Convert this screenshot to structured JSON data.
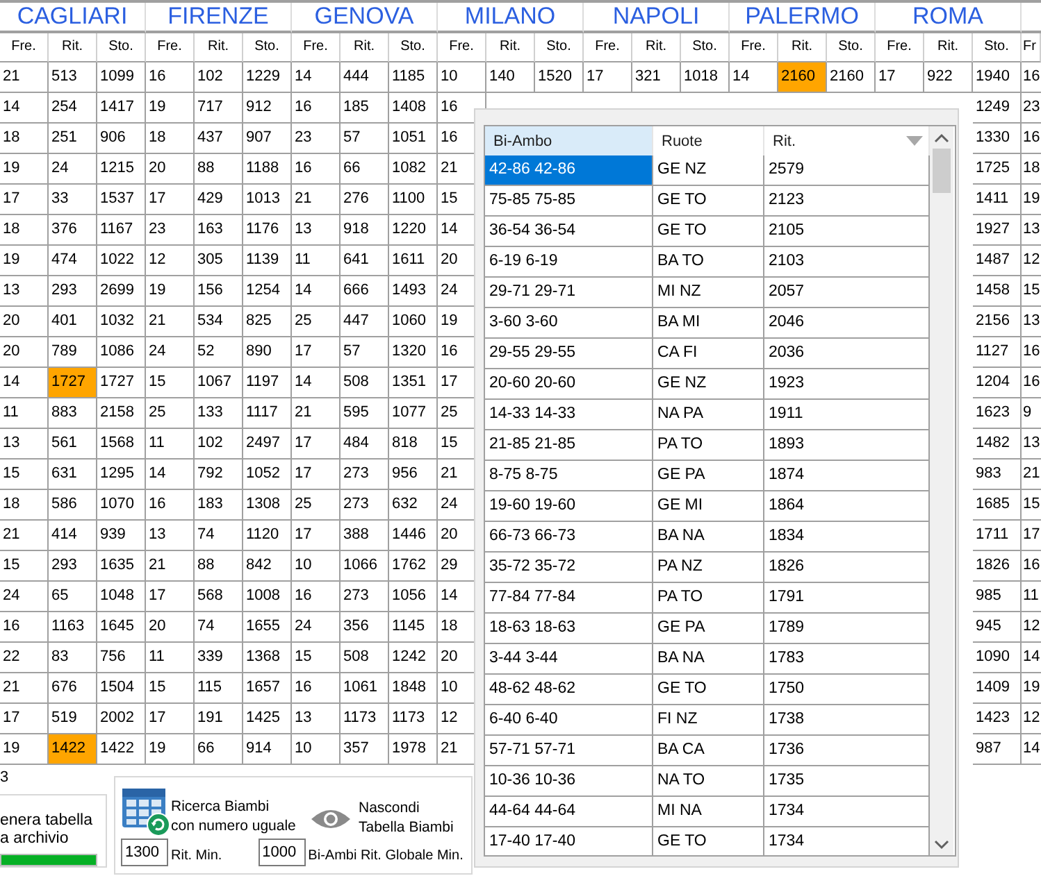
{
  "table": {
    "cities": [
      "CAGLIARI",
      "FIRENZE",
      "GENOVA",
      "MILANO",
      "NAPOLI",
      "PALERMO",
      "ROMA"
    ],
    "column_headers": [
      "Fre.",
      "Rit.",
      "Sto.",
      "Fre.",
      "Rit.",
      "Sto.",
      "Fre.",
      "Rit.",
      "Sto.",
      "Fre.",
      "Rit.",
      "Sto.",
      "Fre.",
      "Rit.",
      "Sto.",
      "Fre.",
      "Rit.",
      "Sto.",
      "Fre.",
      "Rit.",
      "Sto.",
      "Fr"
    ],
    "rows": [
      {
        "cells": [
          "21",
          "513",
          "1099",
          "16",
          "102",
          "1229",
          "14",
          "444",
          "1185",
          "10",
          "140",
          "1520",
          "17",
          "321",
          "1018",
          "14",
          {
            "text": "2160",
            "highlighted": true
          },
          "2160",
          "17",
          "922",
          "1940",
          "16"
        ]
      },
      {
        "cells": [
          "14",
          "254",
          "1417",
          "19",
          "717",
          "912",
          "16",
          "185",
          "1408",
          "16"
        ],
        "tail": [
          "1249",
          "23"
        ]
      },
      {
        "cells": [
          "18",
          "251",
          "906",
          "18",
          "437",
          "907",
          "23",
          "57",
          "1051",
          "16"
        ],
        "tail": [
          "1330",
          "16"
        ]
      },
      {
        "cells": [
          "19",
          "24",
          "1215",
          "20",
          "88",
          "1188",
          "16",
          "66",
          "1082",
          "21"
        ],
        "tail": [
          "1725",
          "18"
        ]
      },
      {
        "cells": [
          "17",
          "33",
          "1537",
          "17",
          "429",
          "1013",
          "21",
          "276",
          "1100",
          "15"
        ],
        "tail": [
          "1411",
          "19"
        ]
      },
      {
        "cells": [
          "18",
          "376",
          "1167",
          "23",
          "163",
          "1176",
          "13",
          "918",
          "1220",
          "14"
        ],
        "tail": [
          "1927",
          "13"
        ]
      },
      {
        "cells": [
          "19",
          "474",
          "1022",
          "12",
          "305",
          "1139",
          "11",
          "641",
          "1611",
          "20"
        ],
        "tail": [
          "1487",
          "12"
        ]
      },
      {
        "cells": [
          "13",
          "293",
          "2699",
          "19",
          "156",
          "1254",
          "14",
          "666",
          "1493",
          "24"
        ],
        "tail": [
          "1458",
          "15"
        ]
      },
      {
        "cells": [
          "20",
          "401",
          "1032",
          "21",
          "534",
          "825",
          "25",
          "447",
          "1060",
          "19"
        ],
        "tail": [
          "2156",
          "13"
        ]
      },
      {
        "cells": [
          "20",
          "789",
          "1086",
          "24",
          "52",
          "890",
          "17",
          "57",
          "1320",
          "16"
        ],
        "tail": [
          "1127",
          "16"
        ]
      },
      {
        "cells": [
          "14",
          {
            "text": "1727",
            "highlighted": true
          },
          "1727",
          "15",
          "1067",
          "1197",
          "14",
          "508",
          "1351",
          "17"
        ],
        "tail": [
          "1204",
          "16"
        ]
      },
      {
        "cells": [
          "11",
          "883",
          "2158",
          "25",
          "133",
          "1117",
          "21",
          "595",
          "1077",
          "25"
        ],
        "tail": [
          "1623",
          "9"
        ]
      },
      {
        "cells": [
          "13",
          "561",
          "1568",
          "11",
          "102",
          "2497",
          "17",
          "484",
          "818",
          "15"
        ],
        "tail": [
          "1482",
          "13"
        ]
      },
      {
        "cells": [
          "15",
          "631",
          "1295",
          "14",
          "792",
          "1052",
          "17",
          "273",
          "956",
          "21"
        ],
        "tail": [
          "983",
          "21"
        ]
      },
      {
        "cells": [
          "18",
          "586",
          "1070",
          "16",
          "183",
          "1308",
          "25",
          "273",
          "632",
          "24"
        ],
        "tail": [
          "1685",
          "15"
        ]
      },
      {
        "cells": [
          "21",
          "414",
          "939",
          "13",
          "74",
          "1120",
          "17",
          "388",
          "1446",
          "20"
        ],
        "tail": [
          "1711",
          "17"
        ]
      },
      {
        "cells": [
          "15",
          "293",
          "1635",
          "21",
          "88",
          "842",
          "10",
          "1066",
          "1762",
          "29"
        ],
        "tail": [
          "1826",
          "16"
        ]
      },
      {
        "cells": [
          "24",
          "65",
          "1048",
          "17",
          "568",
          "1008",
          "16",
          "273",
          "1056",
          "14"
        ],
        "tail": [
          "985",
          "11"
        ]
      },
      {
        "cells": [
          "16",
          "1163",
          "1645",
          "20",
          "74",
          "1655",
          "24",
          "356",
          "1145",
          "18"
        ],
        "tail": [
          "945",
          "12"
        ]
      },
      {
        "cells": [
          "22",
          "83",
          "756",
          "11",
          "339",
          "1368",
          "15",
          "508",
          "1242",
          "20"
        ],
        "tail": [
          "1090",
          "14"
        ]
      },
      {
        "cells": [
          "21",
          "676",
          "1504",
          "15",
          "115",
          "1657",
          "16",
          "1061",
          "1848",
          "10"
        ],
        "tail": [
          "1409",
          "19"
        ]
      },
      {
        "cells": [
          "17",
          "519",
          "2002",
          "17",
          "191",
          "1425",
          "13",
          "1173",
          "1173",
          "12"
        ],
        "tail": [
          "1423",
          "12"
        ]
      },
      {
        "cells": [
          "19",
          {
            "text": "1422",
            "highlighted": true
          },
          "1422",
          "19",
          "66",
          "914",
          "10",
          "357",
          "1978",
          "21"
        ],
        "tail": [
          "987",
          "14"
        ]
      }
    ]
  },
  "biambi_table": {
    "columns": [
      {
        "label": "Bi-Ambo",
        "highlighted": true,
        "sorted": false
      },
      {
        "label": "Ruote",
        "highlighted": false,
        "sorted": false
      },
      {
        "label": "Rit.",
        "highlighted": false,
        "sorted": true
      }
    ],
    "rows": [
      {
        "cells": [
          "42-86 42-86",
          "GE NZ",
          "2579"
        ],
        "selected": true
      },
      {
        "cells": [
          "75-85 75-85",
          "GE TO",
          "2123"
        ],
        "selected": false
      },
      {
        "cells": [
          "36-54 36-54",
          "GE TO",
          "2105"
        ],
        "selected": false
      },
      {
        "cells": [
          "6-19 6-19",
          "BA TO",
          "2103"
        ],
        "selected": false
      },
      {
        "cells": [
          "29-71 29-71",
          "MI NZ",
          "2057"
        ],
        "selected": false
      },
      {
        "cells": [
          "3-60 3-60",
          "BA MI",
          "2046"
        ],
        "selected": false
      },
      {
        "cells": [
          "29-55 29-55",
          "CA FI",
          "2036"
        ],
        "selected": false
      },
      {
        "cells": [
          "20-60 20-60",
          "GE NZ",
          "1923"
        ],
        "selected": false
      },
      {
        "cells": [
          "14-33 14-33",
          "NA PA",
          "1911"
        ],
        "selected": false
      },
      {
        "cells": [
          "21-85 21-85",
          "PA TO",
          "1893"
        ],
        "selected": false
      },
      {
        "cells": [
          "8-75 8-75",
          "GE PA",
          "1874"
        ],
        "selected": false
      },
      {
        "cells": [
          "19-60 19-60",
          "GE MI",
          "1864"
        ],
        "selected": false
      },
      {
        "cells": [
          "66-73 66-73",
          "BA NA",
          "1834"
        ],
        "selected": false
      },
      {
        "cells": [
          "35-72 35-72",
          "PA NZ",
          "1826"
        ],
        "selected": false
      },
      {
        "cells": [
          "77-84 77-84",
          "PA TO",
          "1791"
        ],
        "selected": false
      },
      {
        "cells": [
          "18-63 18-63",
          "GE PA",
          "1789"
        ],
        "selected": false
      },
      {
        "cells": [
          "3-44 3-44",
          "BA NA",
          "1783"
        ],
        "selected": false
      },
      {
        "cells": [
          "48-62 48-62",
          "GE TO",
          "1750"
        ],
        "selected": false
      },
      {
        "cells": [
          "6-40 6-40",
          "FI NZ",
          "1738"
        ],
        "selected": false
      },
      {
        "cells": [
          "57-71 57-71",
          "BA CA",
          "1736"
        ],
        "selected": false
      },
      {
        "cells": [
          "10-36 10-36",
          "NA TO",
          "1735"
        ],
        "selected": false
      },
      {
        "cells": [
          "44-64 44-64",
          "MI NA",
          "1734"
        ],
        "selected": false
      },
      {
        "cells": [
          "17-40 17-40",
          "GE TO",
          "1734"
        ],
        "selected": false
      }
    ]
  },
  "counter": "3",
  "generate": {
    "text": "enera tabella\na archivio",
    "level": 1
  },
  "search_button": {
    "text": "Ricerca Biambi\ncon numero uguale"
  },
  "hide_button": {
    "text": "Nascondi\nTabella Biambi"
  },
  "fields": [
    {
      "value": "1300",
      "label": "Rit. Min."
    },
    {
      "value": "1000",
      "label": "Bi-Ambi Rit. Globale Min."
    }
  ]
}
